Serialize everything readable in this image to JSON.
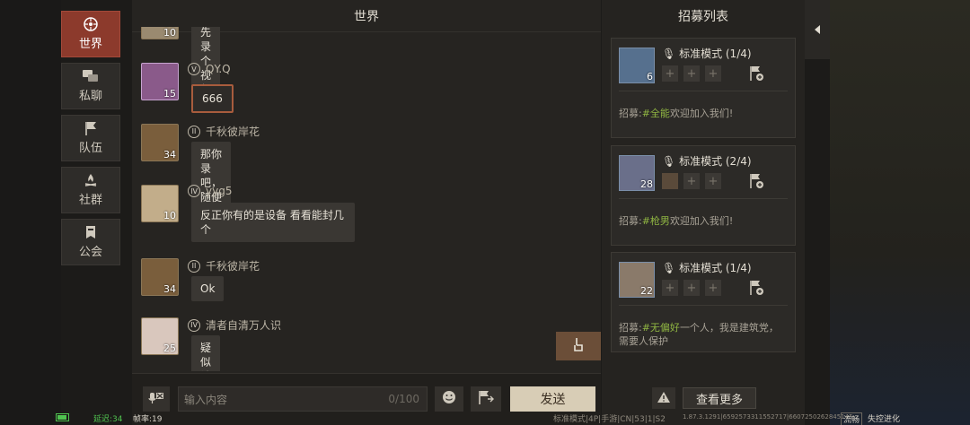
{
  "sidebar": {
    "items": [
      {
        "label": "世界",
        "icon": "globe-icon",
        "active": true
      },
      {
        "label": "私聊",
        "icon": "chat-bubbles-icon",
        "active": false
      },
      {
        "label": "队伍",
        "icon": "flag-icon",
        "active": false
      },
      {
        "label": "社群",
        "icon": "campfire-icon",
        "active": false
      },
      {
        "label": "公会",
        "icon": "banner-icon",
        "active": false
      }
    ]
  },
  "chat": {
    "title": "世界",
    "messages": [
      {
        "name": "",
        "level": "10",
        "badge": "",
        "text": "先录个视频"
      },
      {
        "name": "QY.Q",
        "level": "15",
        "badge": "V",
        "text": "666"
      },
      {
        "name": "千秋彼岸花",
        "level": "34",
        "badge": "II",
        "text": "那你录吧，随便录。"
      },
      {
        "name": "yyg5",
        "level": "10",
        "badge": "IV",
        "text": "反正你有的是设备  看看能封几个"
      },
      {
        "name": "千秋彼岸花",
        "level": "34",
        "badge": "II",
        "text": "Ok"
      },
      {
        "name": "清者自清万人识",
        "level": "25",
        "badge": "IV",
        "text": "疑似被打破防"
      }
    ],
    "input_placeholder": "输入内容",
    "char_count": "0/100",
    "send_label": "发送"
  },
  "recruit": {
    "title": "招募列表",
    "cards": [
      {
        "level": "6",
        "mode": "标准模式 (1/4)",
        "desc_prefix": "招募:",
        "tag": "#全能",
        "desc_rest": "欢迎加入我们!"
      },
      {
        "level": "28",
        "mode": "标准模式 (2/4)",
        "desc_prefix": "招募:",
        "tag": "#枪男",
        "desc_rest": "欢迎加入我们!"
      },
      {
        "level": "22",
        "mode": "标准模式 (1/4)",
        "desc_prefix": "招募:",
        "tag": "#无偏好",
        "desc_rest": "一个人，我是建筑党，需要人保护"
      }
    ],
    "more_label": "查看更多"
  },
  "status": {
    "ping": "延迟:34",
    "fps": "帧率:19",
    "mode": "标准模式|4P|手游|CN|53|1|S2",
    "version": "1.87.3.1291|6592573311552717|6607250262845145",
    "net": "流畅",
    "brand": "失控进化"
  },
  "colors": {
    "accent_red": "#8c3a2c",
    "tag_green": "#8fb542",
    "ping_green": "#4fc24f"
  }
}
